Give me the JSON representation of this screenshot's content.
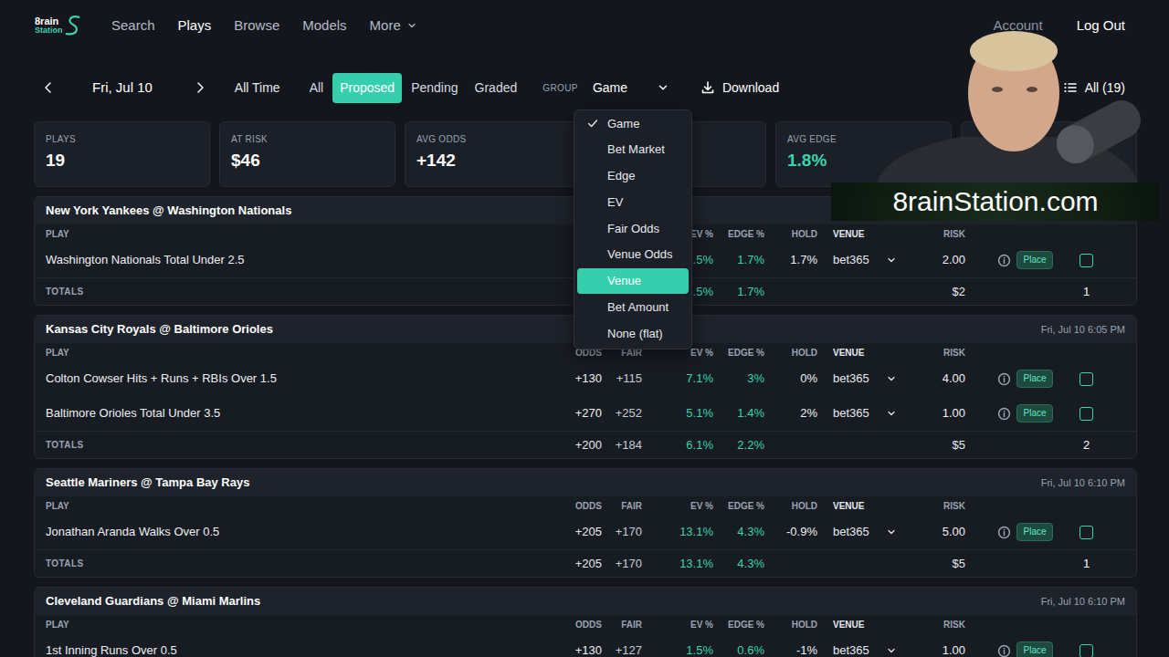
{
  "nav": {
    "logo": [
      "8rain",
      "Station"
    ],
    "links": [
      {
        "label": "Search",
        "selected": false,
        "has_menu": false
      },
      {
        "label": "Plays",
        "selected": true,
        "has_menu": false
      },
      {
        "label": "Browse",
        "selected": false,
        "has_menu": false
      },
      {
        "label": "Models",
        "selected": false,
        "has_menu": false
      },
      {
        "label": "More",
        "selected": false,
        "has_menu": true
      }
    ],
    "account": "Account",
    "logout": "Log Out"
  },
  "toolbar": {
    "date": "Fri, Jul 10",
    "range": "All Time",
    "filters": [
      {
        "label": "All",
        "selected": false
      },
      {
        "label": "Proposed",
        "selected": true
      },
      {
        "label": "Pending",
        "selected": false
      },
      {
        "label": "Graded",
        "selected": false
      }
    ],
    "group_label": "GROUP",
    "group_value": "Game",
    "download": "Download",
    "columns_button": "All (19)"
  },
  "group_menu": {
    "expanded": true,
    "items": [
      {
        "label": "Game",
        "checked": true,
        "highlighted": false
      },
      {
        "label": "Bet Market",
        "checked": false,
        "highlighted": false
      },
      {
        "label": "Edge",
        "checked": false,
        "highlighted": false
      },
      {
        "label": "EV",
        "checked": false,
        "highlighted": false
      },
      {
        "label": "Fair Odds",
        "checked": false,
        "highlighted": false
      },
      {
        "label": "Venue Odds",
        "checked": false,
        "highlighted": false
      },
      {
        "label": "Venue",
        "checked": false,
        "highlighted": true
      },
      {
        "label": "Bet Amount",
        "checked": false,
        "highlighted": false
      },
      {
        "label": "None (flat)",
        "checked": false,
        "highlighted": false
      }
    ]
  },
  "stats": [
    {
      "label": "PLAYS",
      "value": "19",
      "accent": false
    },
    {
      "label": "AT RISK",
      "value": "$46",
      "accent": false
    },
    {
      "label": "AVG ODDS",
      "value": "+142",
      "accent": false
    },
    {},
    {
      "label": "AVG EDGE",
      "value": "1.8%",
      "accent": true
    },
    {}
  ],
  "games": [
    {
      "title": "New York Yankees @ Washington Nationals",
      "columns": [
        "PLAY",
        null,
        null,
        "EV %",
        "EDGE %",
        "HOLD",
        "VENUE",
        "RISK"
      ],
      "plays": [
        {
          "play": "Washington Nationals Total Under 2.5",
          "odds": null,
          "fair": null,
          "ev": "5.5%",
          "edge": "1.7%",
          "hold": "1.7%",
          "venue": "bet365",
          "risk": "2.00",
          "action": "Place",
          "checked": false
        }
      ],
      "totals": {
        "label": "TOTALS",
        "odds": null,
        "fair": null,
        "ev": "5.5%",
        "edge": "1.7%",
        "risk": "$2",
        "count": "1"
      }
    },
    {
      "title": "Kansas City Royals @ Baltimore Orioles",
      "date": "Fri, Jul 10 6:05 PM",
      "columns": [
        "PLAY",
        "ODDS",
        "FAIR",
        "EV %",
        "EDGE %",
        "HOLD",
        "VENUE",
        "RISK"
      ],
      "plays": [
        {
          "play": "Colton Cowser Hits + Runs + RBIs Over 1.5",
          "odds": "+130",
          "fair": "+115",
          "ev": "7.1%",
          "edge": "3%",
          "hold": "0%",
          "venue": "bet365",
          "risk": "4.00",
          "action": "Place",
          "checked": false
        },
        {
          "play": "Baltimore Orioles Total Under 3.5",
          "odds": "+270",
          "fair": "+252",
          "ev": "5.1%",
          "edge": "1.4%",
          "hold": "2%",
          "venue": "bet365",
          "risk": "1.00",
          "action": "Place",
          "checked": false
        }
      ],
      "totals": {
        "label": "TOTALS",
        "odds": "+200",
        "fair": "+184",
        "ev": "6.1%",
        "edge": "2.2%",
        "risk": "$5",
        "count": "2"
      }
    },
    {
      "title": "Seattle Mariners @ Tampa Bay Rays",
      "date": "Fri, Jul 10 6:10 PM",
      "columns": [
        "PLAY",
        "ODDS",
        "FAIR",
        "EV %",
        "EDGE %",
        "HOLD",
        "VENUE",
        "RISK"
      ],
      "plays": [
        {
          "play": "Jonathan Aranda Walks Over 0.5",
          "odds": "+205",
          "fair": "+170",
          "ev": "13.1%",
          "edge": "4.3%",
          "hold": "-0.9%",
          "venue": "bet365",
          "risk": "5.00",
          "action": "Place",
          "checked": false
        }
      ],
      "totals": {
        "label": "TOTALS",
        "odds": "+205",
        "fair": "+170",
        "ev": "13.1%",
        "edge": "4.3%",
        "risk": "$5",
        "count": "1"
      }
    },
    {
      "title": "Cleveland Guardians @ Miami Marlins",
      "date": "Fri, Jul 10 6:10 PM",
      "columns": [
        "PLAY",
        "ODDS",
        "FAIR",
        "EV %",
        "EDGE %",
        "HOLD",
        "VENUE",
        "RISK"
      ],
      "plays": [
        {
          "play": "1st Inning Runs Over 0.5",
          "odds": "+130",
          "fair": "+127",
          "ev": "1.5%",
          "edge": "0.6%",
          "hold": "-1%",
          "venue": "bet365",
          "risk": "1.00",
          "action": "Place",
          "checked": false
        }
      ]
    }
  ],
  "overlay": {
    "watermark": "8rainStation.com"
  }
}
